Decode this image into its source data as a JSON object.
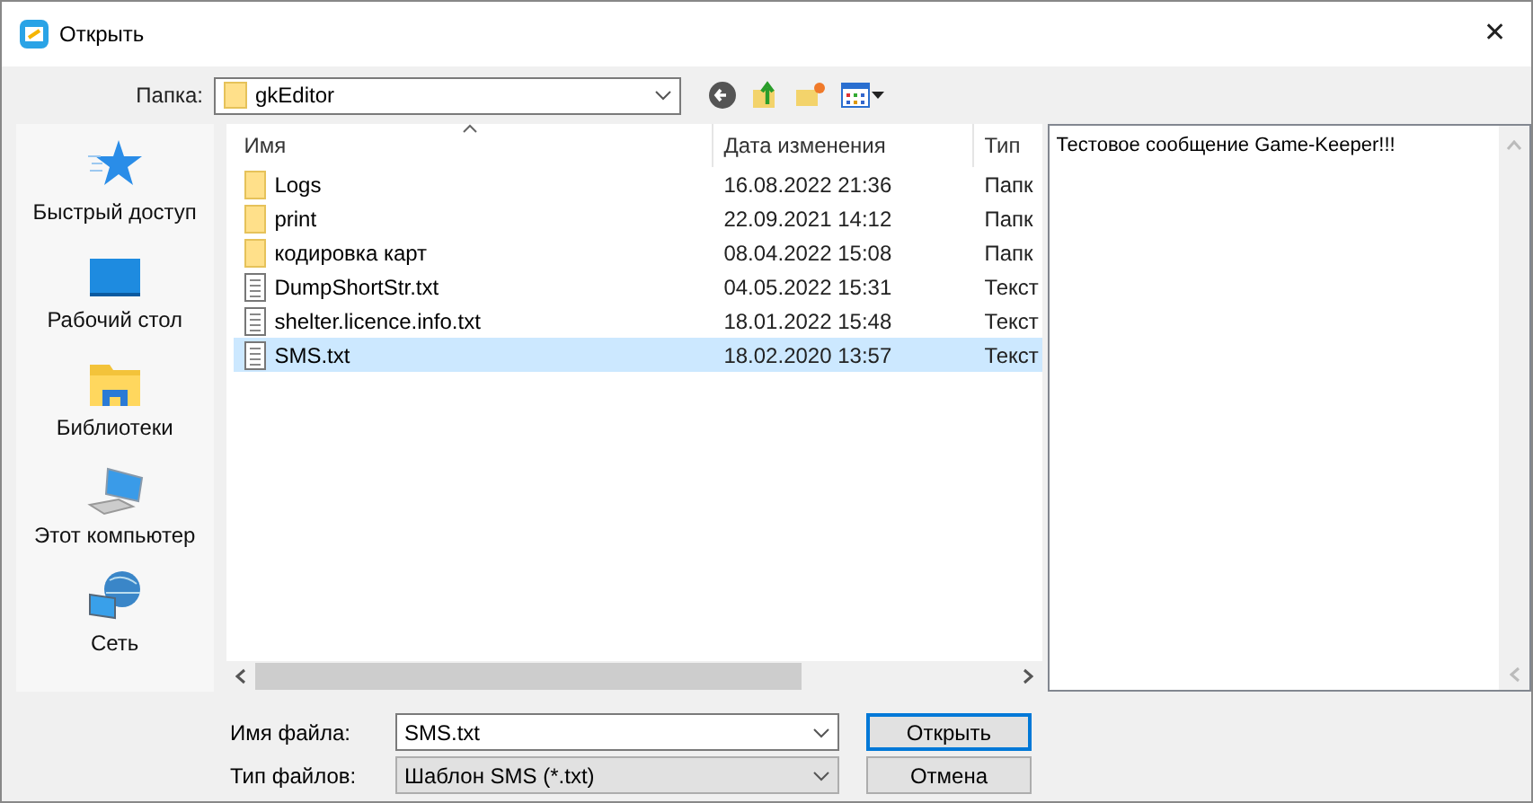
{
  "window": {
    "title": "Открыть",
    "close": "✕"
  },
  "folder": {
    "label": "Папка:",
    "value": "gkEditor"
  },
  "places": [
    {
      "label": "Быстрый доступ",
      "kind": "star"
    },
    {
      "label": "Рабочий стол",
      "kind": "desktop"
    },
    {
      "label": "Библиотеки",
      "kind": "library"
    },
    {
      "label": "Этот компьютер",
      "kind": "computer"
    },
    {
      "label": "Сеть",
      "kind": "network"
    }
  ],
  "table": {
    "columns": [
      "Имя",
      "Дата изменения",
      "Тип"
    ],
    "rows": [
      {
        "name": "Logs",
        "date": "16.08.2022 21:36",
        "type": "Папк",
        "kind": "folder",
        "selected": false
      },
      {
        "name": "print",
        "date": "22.09.2021 14:12",
        "type": "Папк",
        "kind": "folder",
        "selected": false
      },
      {
        "name": "кодировка карт",
        "date": "08.04.2022 15:08",
        "type": "Папк",
        "kind": "folder",
        "selected": false
      },
      {
        "name": "DumpShortStr.txt",
        "date": "04.05.2022 15:31",
        "type": "Текст",
        "kind": "file",
        "selected": false
      },
      {
        "name": "shelter.licence.info.txt",
        "date": "18.01.2022 15:48",
        "type": "Текст",
        "kind": "file",
        "selected": false
      },
      {
        "name": "SMS.txt",
        "date": "18.02.2020 13:57",
        "type": "Текст",
        "kind": "file",
        "selected": true
      }
    ]
  },
  "preview": {
    "text": "Тестовое сообщение Game-Keeper!!!"
  },
  "file_name": {
    "label": "Имя файла:",
    "value": "SMS.txt"
  },
  "file_type": {
    "label": "Тип файлов:",
    "value": "Шаблон SMS (*.txt)"
  },
  "buttons": [
    {
      "label": "Открыть",
      "default": true
    },
    {
      "label": "Отмена",
      "default": false
    }
  ]
}
